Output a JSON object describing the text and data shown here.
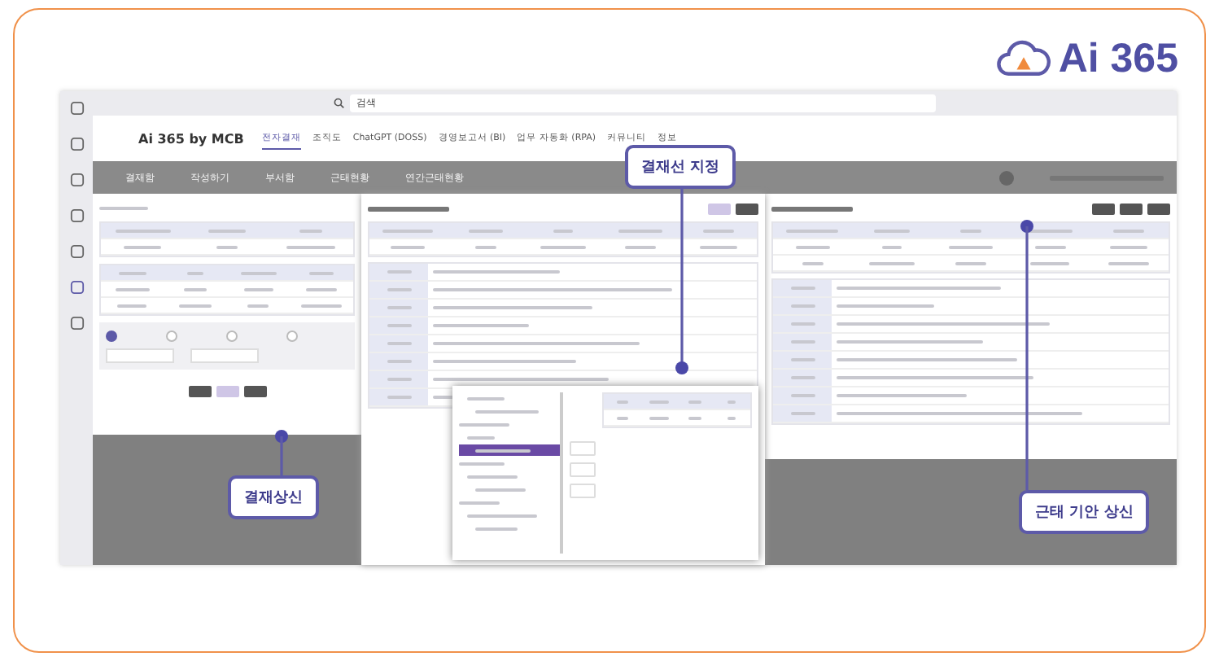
{
  "logo": {
    "text": "Ai 365"
  },
  "app": {
    "search_placeholder": "검색",
    "brand": "Ai 365 by MCB",
    "nav": [
      {
        "label": "전자결재",
        "selected": true
      },
      {
        "label": "조직도",
        "selected": false
      },
      {
        "label": "ChatGPT (DOSS)",
        "selected": false
      },
      {
        "label": "경영보고서 (BI)",
        "selected": false
      },
      {
        "label": "업무 자동화 (RPA)",
        "selected": false
      },
      {
        "label": "커뮤니티",
        "selected": false
      },
      {
        "label": "정보",
        "selected": false
      }
    ],
    "subnav": [
      "결재함",
      "작성하기",
      "부서함",
      "근태현황",
      "연간근태현황"
    ]
  },
  "options": [
    {
      "selected": true
    },
    {
      "selected": false
    },
    {
      "selected": false
    },
    {
      "selected": false
    }
  ],
  "tree": [
    {
      "selected": false
    },
    {
      "selected": false
    },
    {
      "selected": false
    },
    {
      "selected": false
    },
    {
      "selected": true
    },
    {
      "selected": false
    },
    {
      "selected": false
    },
    {
      "selected": false
    },
    {
      "selected": false
    },
    {
      "selected": false
    },
    {
      "selected": false
    }
  ],
  "callouts": [
    {
      "text": "결재선 지정"
    },
    {
      "text": "결재상신"
    },
    {
      "text": "근태 기안 상신"
    }
  ]
}
